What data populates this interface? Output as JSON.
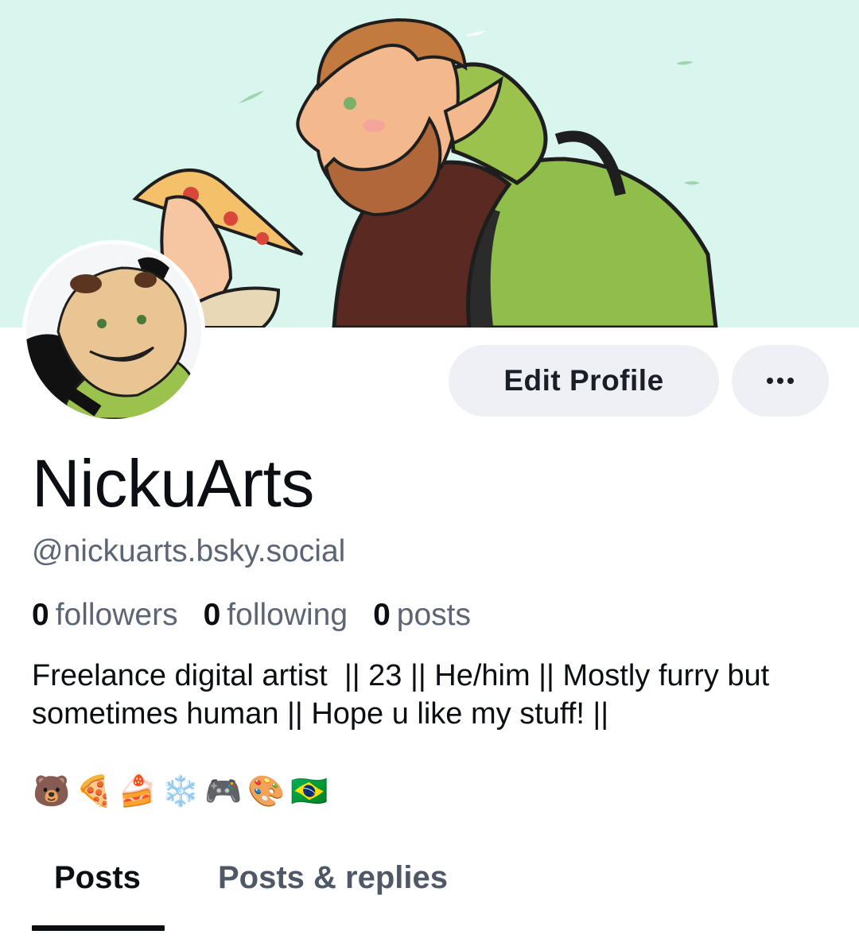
{
  "profile": {
    "display_name": "NickuArts",
    "handle": "@nickuarts.bsky.social",
    "bio": "Freelance digital artist  || 23 || He/him || Mostly furry but sometimes human || Hope u like my stuff! ||",
    "emojis": [
      "🐻",
      "🍕",
      "🍰",
      "❄️",
      "🎮",
      "🎨",
      "🇧🇷"
    ]
  },
  "actions": {
    "edit_label": "Edit Profile",
    "more_icon": "ellipsis-icon"
  },
  "stats": {
    "followers_count": "0",
    "followers_label": "followers",
    "following_count": "0",
    "following_label": "following",
    "posts_count": "0",
    "posts_label": "posts"
  },
  "tabs": [
    {
      "label": "Posts",
      "active": true
    },
    {
      "label": "Posts & replies",
      "active": false
    }
  ],
  "colors": {
    "banner_bg": "#d9f6ee",
    "button_bg": "#eef0f5",
    "text_primary": "#0b0f14",
    "text_secondary": "#5c6573"
  }
}
